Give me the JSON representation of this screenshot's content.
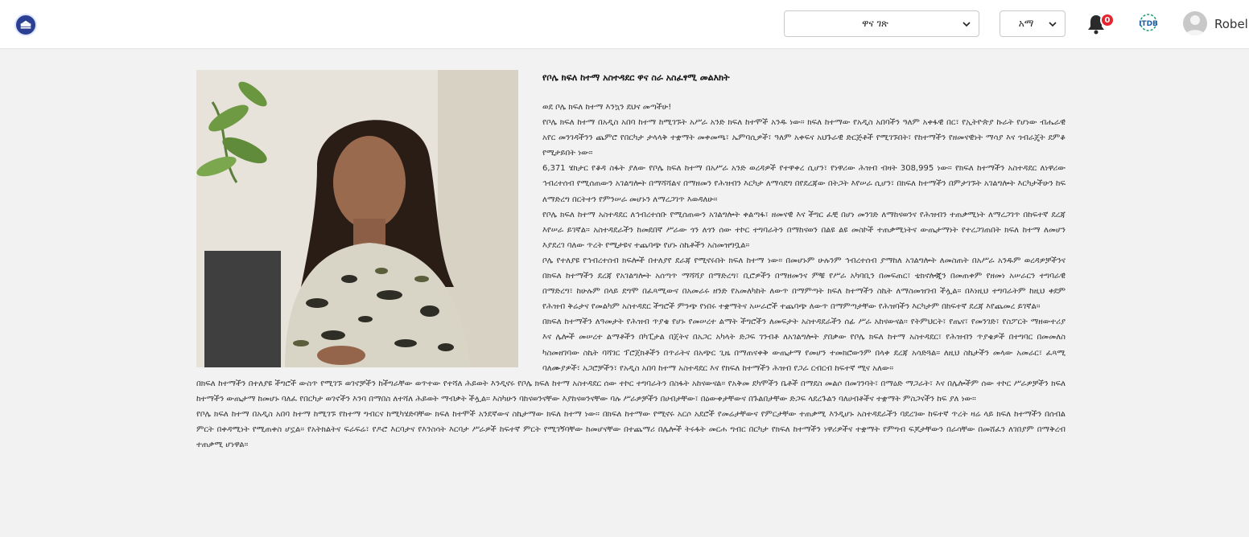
{
  "header": {
    "page_select": {
      "value": "ዋና ገጽ"
    },
    "lang_select": {
      "value": "አማ"
    },
    "notifications": {
      "count": "0"
    },
    "org_logo_text": "ITDB",
    "user": {
      "name": "Robel"
    }
  },
  "article": {
    "title": "የቦሌ ክፍለ ከተማ አስተዳደር ዋና ስራ አስፈፃሚ መልእክት",
    "photo_icon": "person-photo",
    "paragraphs": [
      "ወደ ቦሌ ክፍለ ከተማ እንኳን ደህና መጣችሁ!",
      "የቦሌ ክፍለ ከተማ በአዲስ አበባ ከተማ ከሚገኙት አሥራ አንድ ክፍለ ከተሞች አንዱ ነው። ክፍለ ከተማው የአዲስ አበባችን ዓለም አቀፋዊ በር፣ የኢትዮጵያ ኩራት የሆነው ብሔራዊ አየር መንገዳችንን ጨምሮ የበርካታ ታላላቅ ተቋማት መቀመጫ፣ ኤምባሲዎች፣ ዓለም አቀፍና አህጉራዊ ድርጅቶች የሚገኙበት፣ የከተማችን የዘመናዊነት ማሳያ እና ጎብራጄት ደምቆ የሚታይበት ነው።",
      "6,371 ሄክታር የቆዳ ስፋት ያለው የቦሌ ክፍለ ከተማ በአሥራ አንድ ወረዳዎች የተዋቀረ ሲሆን፣ የነዋሪው ሕዝብ ብዛት 308,995 ነው። የክፍለ ከተማችን አስተዳደር ለነዋሪው ኅብረተሰብ የሚሰጠውን አገልግሎት በማሻሻልና በማዘመን የሕዝብን እርካታ ለማሳደግ በየደረጃው በትጋት እየሠራ ሲሆን፣ በክፍለ ከተማችን በምታገኙት አገልግሎት እርካታችሁን ከፍ ለማድረግ በርትተን የምንሠራ መሆኑን ለማረጋገጥ እወዳለሁ።",
      "የቦሌ ክፍለ ከተማ አስተዳደር ለኅብረተሰቡ የሚሰጠውን አገልግሎት ቀልጣፋ፣ ዘመናዊ እና ችግር ፈቺ በሆነ መንገድ ለማከናወንና የሕዝብን ተጠቃሚነት ለማረጋገጥ በከፍተኛ ደረጃ እየሠራ ይገኛል። አስተዳደራችን ከመደበኛ ሥራው ጎን ለጎን ሰው ተኮር ተግባራትን በማከናወን በልዩ ልዩ መስኮች ተጠቃሚነትና ውጤታማነት የተረጋገጠበት ክፍለ ከተማ ለመሆን እያደረገ ባለው ጥረት የሚታዩና ተጨባጭ የሆኑ ስኬቶችን አስመዝግቧል።",
      "ቦሌ የተለያዩ የኅብረተሰብ ክፍሎች በተለያየ ደራጃ የሚኖሩበት ክፍለ ከተማ ነው። በመሆኑም ሁሉንም ኅብረተሰብ ያማከለ አገልግሎት ለመስጠት በአሥራ አንዱም ወረዳዎቻችንና በክፍለ ከተማችን ደረጃ የአገልግሎት አሰጣጥ ማሻሻያ በማድረግ፣ ቢሮዎችን በማዘመንና ምቹ የሥራ አካባቢን በመፍጠር፣ ቴክኖሎጂን በመጠቀም የዘመነ አሠራርን ተግባራዊ በማድረግ፣ ከሁሉም በላይ ደግሞ በፈጻሚውና በአመራሩ ዘንድ የአመለካከት ለውጥ በማምጣት ክፍለ ከተማችን ስኬት ለማስመዝገብ ችሏል። በእነዚህ ተግባራትም ከዚህ ቀደም የሕዝብ ቅሬታና የመልካም አስተዳደር ችግሮች ምንጭ የነበሩ ተቋማትና አሠራሮች ተጨባጭ ለውጥ በማምጣታቸው የሕዝባችን እርካታም በከፍተኛ ደረጃ እየጨመረ ይገኛል።",
      "በክፍለ ከተማችን ለዓመታት የሕዝብ ጥያቄ የሆኑ የመሠረተ ልማት ችግሮችን ለመፍታት አስተዳደራችን ሰፊ ሥራ አከናውናል። የትምህርት፣ የጤና፣ የመንገድ፣ የስፖርት ማዘውተሪያ እና ሌሎች መሠረተ ልማቶችን በካፒታል በጀትና በአጋር አካላት ድጋፍ ገንብቶ ለአገልግሎት ያበቃው የቦሌ ክፍለ ከተማ አስተዳደር፣ የሕዝብን ጥያቄዎች በተግባር በመመለስ ካስመዘገባው ስኬት ባሻገር ፕሮጀክቶችን በጥራትና በአጭር ጊዜ በማጠናቀቅ ውጤታማ የመሆን ተመክሮውንም በላቀ ደረጃ አሳድጓል። ለዚህ ስኬታችን መላው አመራር፣ ፈጻሚ ባለሙያዎች፣ አጋሮቻችን፣ የአዲስ አበባ ከተማ አስተዳደር እና የክፍለ ከተማችን ሕዝብ የጋራ ርብርብ ከፍተኛ ሚና አለው።",
      "በክፍለ ከተማችን በተለያዩ ችግሮች ውስጥ የሚገኙ ወገኖቻችን ከችግራቸው ወጥተው የተሻለ ሕይወት እንዲኖሩ የቦሌ ክፍለ ከተማ አስተዳደር ሰው ተኮር ተግባራትን በስፋት አከናውናል። የአቅመ ደካሞችን ቤቶች በማደስ መልሶ በመገንባት፣ በማዕድ ማጋራት፣ እና በሌሎችም ሰው ተኮር ሥራዎቻችን ክፍለ ከተማችን ውጤታማ ከመሆኑ ባለፈ የበርካታ ወገኖችን እንባ በማበስ ለተሻለ ሕይወት ማብቃት ችሏል። እስካሁን ባከናወንናቸው እያከናወንናቸው ባሉ ሥራዎቻችን በሀብታቸው፣ በዕውቀታቸውና በጉልበታቸው ድጋፍ ላደረጉልን ባለሀብቶችና ተቋማት ምስጋናችን ከፍ ያለ ነው።",
      "የቦሌ ክፍለ ከተማ በአዲስ አበባ ከተማ ከሚገኙ የከተማ ግብርና ከሚካሄድባቸው ክፍለ ከተሞች አንደኛውና ስኬታማው ክፍለ ከተማ ነው። በክፍለ ከተማው የሚኖሩ አርሶ አደሮች የመሬታቸውና የምርታቸው ተጠቃሚ እንዲሆኑ አስተዳደራችን ባደረገው ከፍተኛ ጥረት ዛሬ ላይ ክፍለ ከተማችን በሰብል ምርት በቀዳሚነት የሚጠቀስ ሆኗል። የአትክልትና ፍራፍሬ፣ የዶሮ እርባታና የእንስሳት እርባታ ሥራዎች ከፍተኛ ምርት የሚገኝባቸው ከመሆናቸው በተጨማሪ በሌሎች ትሩፋት መርሐ ግብር በርካታ የክፍለ ከተማችን ነዋሪዎችና ተቋማት የምግብ ፍጆታቸውን በራሳቸው በመሸፈን ለገበያም በማቅረብ ተጠቃሚ ሆነዋል።"
    ]
  },
  "colors": {
    "brand_blue": "#2b3f93",
    "badge_red": "#e8232d",
    "itdb_green": "#1f9a6e",
    "page_bg": "#f2f2f2"
  },
  "icons": {
    "logo": "emblem-icon",
    "bell": "bell-icon",
    "chevron": "chevron-down-icon",
    "avatar": "user-avatar-icon"
  }
}
